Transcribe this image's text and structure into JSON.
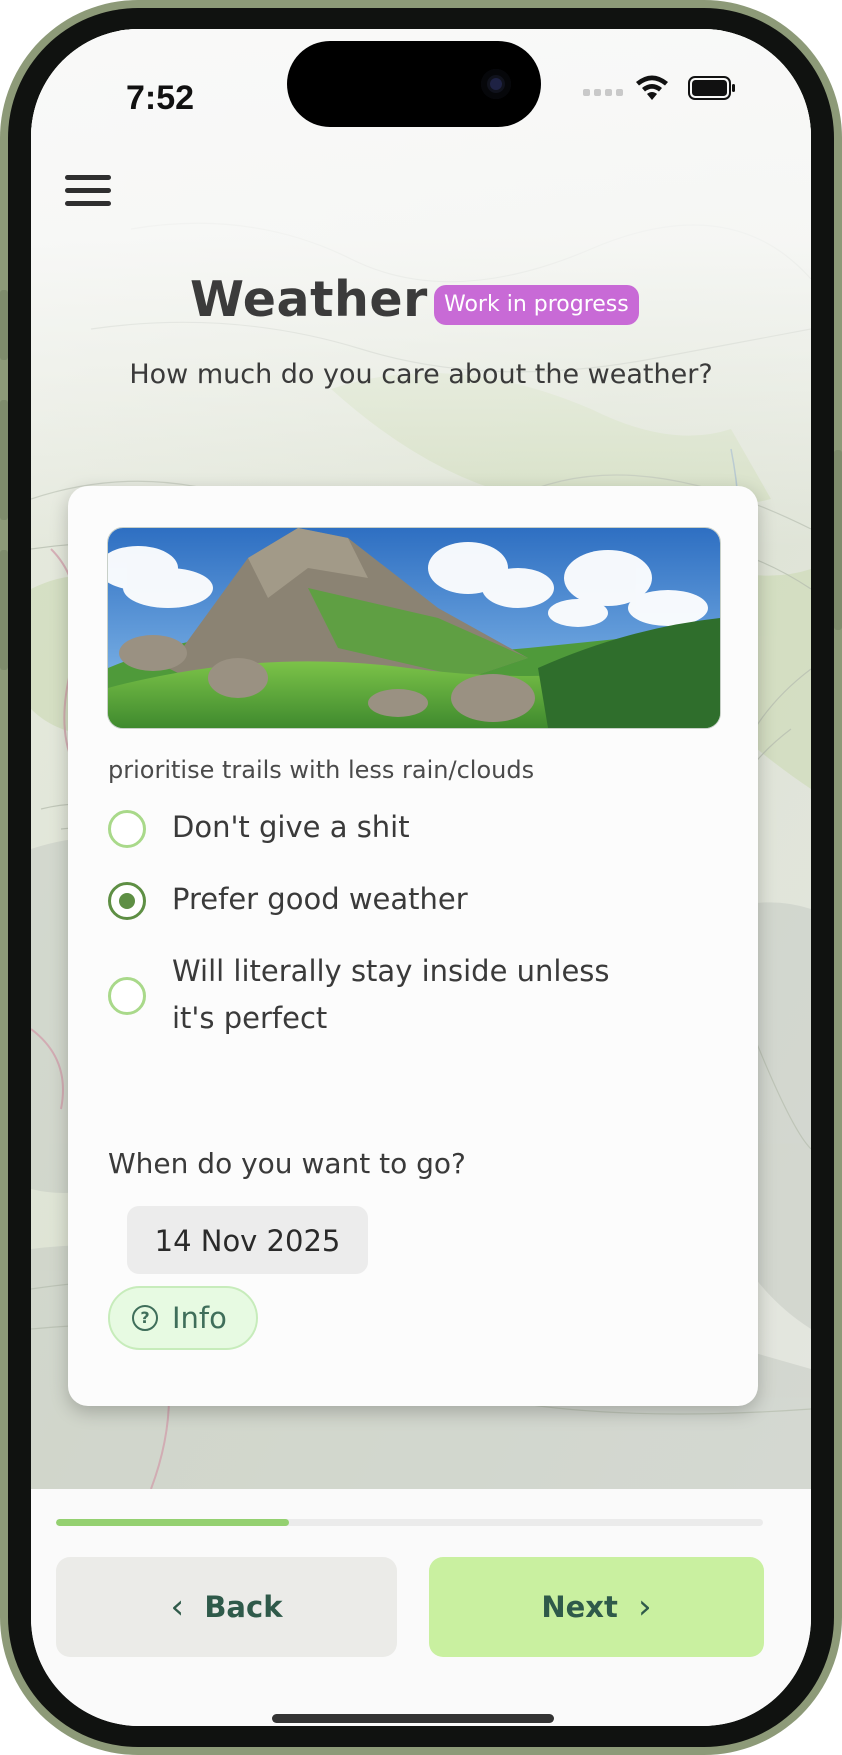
{
  "status_bar": {
    "time": "7:52"
  },
  "page": {
    "title": "Weather",
    "badge": "Work in progress",
    "question": "How much do you care about the weather?"
  },
  "card": {
    "hint": "prioritise trails with less rain/clouds",
    "options": [
      {
        "label": "Don't give a shit",
        "selected": false
      },
      {
        "label": "Prefer good weather",
        "selected": true
      },
      {
        "label": "Will literally stay inside unless it's perfect",
        "selected": false
      }
    ],
    "date_question": "When do you want to go?",
    "date_value": "14 Nov 2025",
    "info_label": "Info"
  },
  "footer": {
    "progress_fraction": 0.33,
    "back_label": "Back",
    "next_label": "Next"
  },
  "colors": {
    "accent_green": "#5e8f44",
    "radio_light": "#a9d98a",
    "badge_purple": "#c86ad6",
    "next_button": "#c9f0a0",
    "progress_fill": "#94d070"
  },
  "icons": [
    "menu-icon",
    "wifi-icon",
    "battery-icon",
    "question-icon",
    "chevron-left-icon",
    "chevron-right-icon"
  ]
}
